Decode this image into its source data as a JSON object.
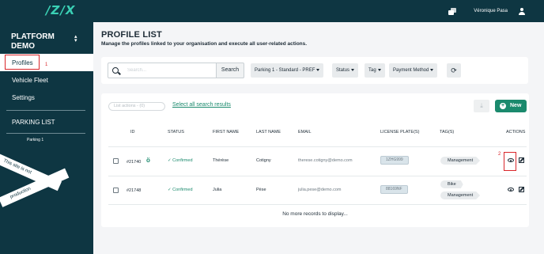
{
  "header": {
    "logo": "/Z/X",
    "username": "Véronique Pasa"
  },
  "sidebar": {
    "platform_name": "PLATFORM DEMO",
    "platform_line1": "PLATFORM",
    "platform_line2": "DEMO",
    "toggle": "⌃⌄",
    "items": [
      {
        "label": "Profiles",
        "active": true
      },
      {
        "label": "Vehicle Fleet"
      },
      {
        "label": "Settings"
      }
    ],
    "parking_list_heading": "PARKING LIST",
    "parking_items": [
      "Parking 1"
    ],
    "ribbon_text_1": "This site is not",
    "ribbon_text_2": "production",
    "annotation_1": "1"
  },
  "main": {
    "title": "PROFILE LIST",
    "subtitle": "Manage the profiles linked to your organisation and execute all user-related actions.",
    "search": {
      "placeholder": "Search...",
      "button": "Search"
    },
    "filters": [
      "Parking 1 - Standard - PREF",
      "Status",
      "Tag",
      "Payment Method"
    ],
    "list_actions": "List actions - (0)",
    "select_all": "Select all search results",
    "new_button": "New",
    "columns": [
      "ID",
      "STATUS",
      "FIRST NAME",
      "LAST NAME",
      "EMAIL",
      "LICENSE PLATE(S)",
      "TAG(S)",
      "ACTIONS"
    ],
    "rows": [
      {
        "id": "#21740",
        "status": "Confirmed",
        "first_name": "Thérèse",
        "last_name": "Cotigny",
        "email": "therese.cotigny@demo.com",
        "plate": "1ZHG999",
        "tags": [
          "Management"
        ]
      },
      {
        "id": "#21748",
        "status": "Confirmed",
        "first_name": "Julia",
        "last_name": "Pèse",
        "email": "julia.pese@demo.com",
        "plate": "88169NF",
        "tags": [
          "Bike",
          "Management"
        ]
      }
    ],
    "no_more": "No more records to display...",
    "annotation_2": "2"
  },
  "colors": {
    "sidebar": "#0e3642",
    "accent": "#1b8a6d",
    "highlight": "#d9262a"
  }
}
